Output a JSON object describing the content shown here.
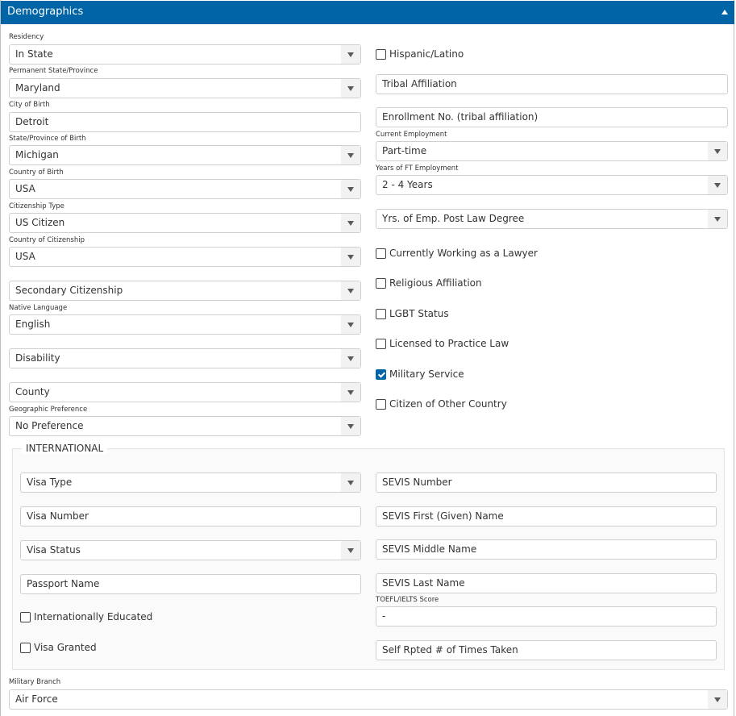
{
  "panel": {
    "title": "Demographics",
    "collapse_icon": "triangle-up-icon",
    "accent_color": "#0064a6"
  },
  "left": {
    "residency": {
      "label": "Residency",
      "value": "In State"
    },
    "permanent_state": {
      "label": "Permanent State/Province",
      "value": "Maryland"
    },
    "city_of_birth": {
      "label": "City of Birth",
      "value": "Detroit"
    },
    "state_of_birth": {
      "label": "State/Province of Birth",
      "value": "Michigan"
    },
    "country_of_birth": {
      "label": "Country of Birth",
      "value": "USA"
    },
    "citizenship_type": {
      "label": "Citizenship Type",
      "value": "US Citizen"
    },
    "country_of_citizenship": {
      "label": "Country of Citizenship",
      "value": "USA"
    },
    "secondary_citizenship": {
      "placeholder": "Secondary Citizenship"
    },
    "native_language": {
      "label": "Native Language",
      "value": "English"
    },
    "disability": {
      "placeholder": "Disability"
    },
    "county": {
      "placeholder": "County"
    },
    "geographic_preference": {
      "label": "Geographic Preference",
      "value": "No Preference"
    }
  },
  "right": {
    "hispanic_latino": {
      "label": "Hispanic/Latino",
      "checked": false
    },
    "tribal_affiliation": {
      "placeholder": "Tribal Affiliation"
    },
    "enrollment_no": {
      "placeholder": "Enrollment No. (tribal affiliation)"
    },
    "current_employment": {
      "label": "Current Employment",
      "value": "Part-time"
    },
    "years_ft_employment": {
      "label": "Years of FT Employment",
      "value": "2 - 4 Years"
    },
    "yrs_emp_post_law": {
      "placeholder": "Yrs. of Emp. Post Law Degree"
    },
    "checkboxes": [
      {
        "label": "Currently Working as a Lawyer",
        "checked": false
      },
      {
        "label": "Religious Affiliation",
        "checked": false
      },
      {
        "label": "LGBT Status",
        "checked": false
      },
      {
        "label": "Licensed to Practice Law",
        "checked": false
      },
      {
        "label": "Military Service",
        "checked": true
      },
      {
        "label": "Citizen of Other Country",
        "checked": false
      }
    ]
  },
  "international": {
    "legend": "INTERNATIONAL",
    "visa_type": {
      "placeholder": "Visa Type"
    },
    "visa_number": {
      "placeholder": "Visa Number"
    },
    "visa_status": {
      "placeholder": "Visa Status"
    },
    "passport_name": {
      "placeholder": "Passport Name"
    },
    "internationally_educated": {
      "label": "Internationally Educated",
      "checked": false
    },
    "visa_granted": {
      "label": "Visa Granted",
      "checked": false
    },
    "sevis_number": {
      "placeholder": "SEVIS Number"
    },
    "sevis_first_name": {
      "placeholder": "SEVIS First (Given) Name"
    },
    "sevis_middle_name": {
      "placeholder": "SEVIS Middle Name"
    },
    "sevis_last_name": {
      "placeholder": "SEVIS Last Name"
    },
    "toefl_score": {
      "label": "TOEFL/IELTS Score",
      "value": "-"
    },
    "self_rpted_times": {
      "placeholder": "Self Rpted # of Times Taken"
    }
  },
  "military_branch": {
    "label": "Military Branch",
    "value": "Air Force"
  }
}
